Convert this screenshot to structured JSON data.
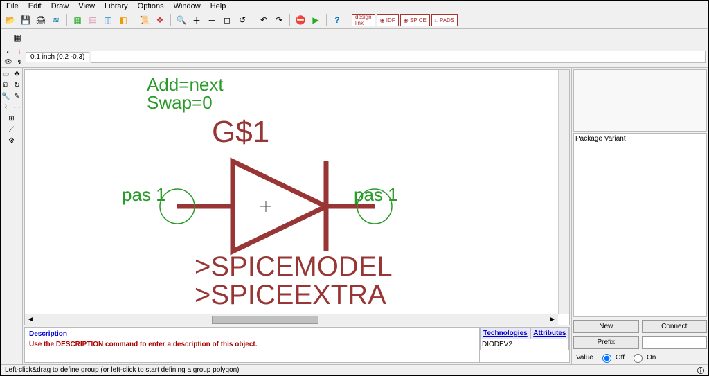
{
  "menu": [
    "File",
    "Edit",
    "Draw",
    "View",
    "Library",
    "Options",
    "Window",
    "Help"
  ],
  "coords": "0.1 inch (0.2 -0.3)",
  "canvas": {
    "add": "Add=next",
    "swap": "Swap=0",
    "gate": "G$1",
    "pin_left": "pas 1",
    "pin_right": "pas 1",
    "spicemodel": ">SPICEMODEL",
    "spiceextra": ">SPICEEXTRA"
  },
  "desc": {
    "head": "Description",
    "body": "Use the DESCRIPTION command to enter a description of this object."
  },
  "tech": {
    "h1": "Technologies",
    "h2": "Attributes",
    "row": "DIODEV2"
  },
  "right": {
    "cols": "Package   Variant",
    "new": "New",
    "connect": "Connect",
    "prefix": "Prefix",
    "value": "Value",
    "off": "Off",
    "on": "On"
  },
  "status": "Left-click&drag to define group (or left-click to start defining a group polygon)"
}
